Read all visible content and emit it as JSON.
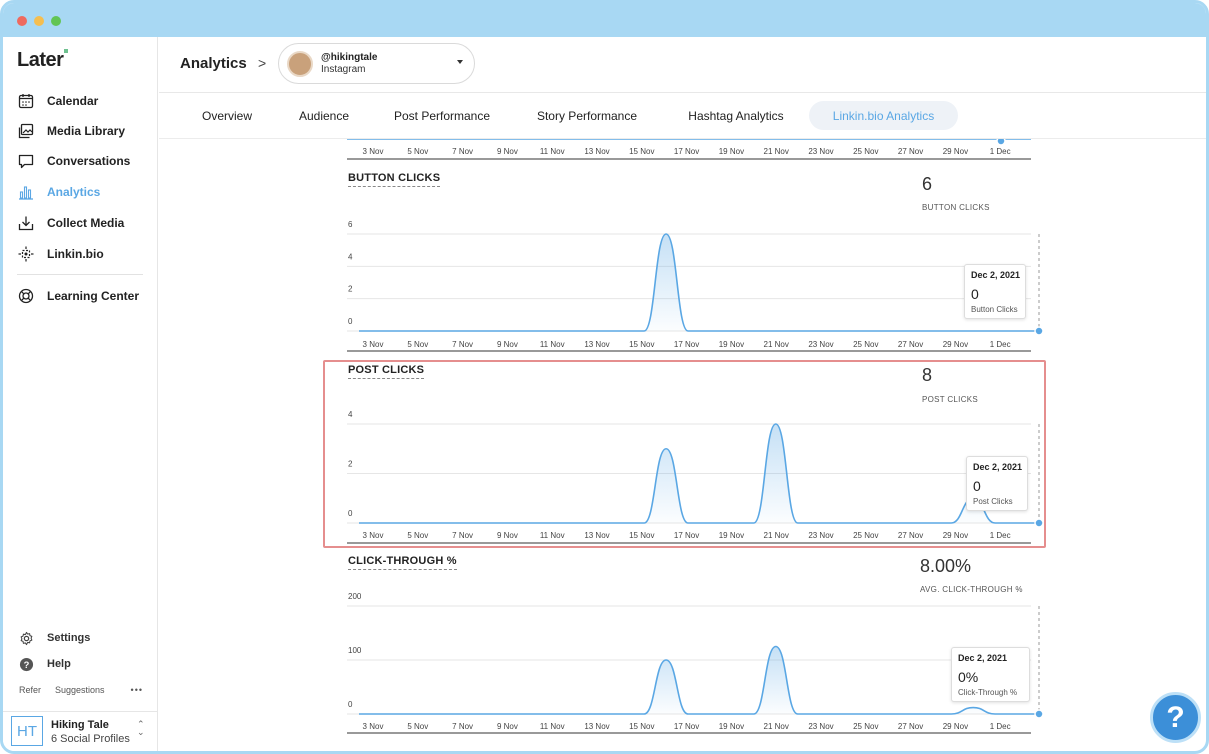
{
  "app": {
    "logo_text": "Later",
    "accent_color": "#5aa7e4"
  },
  "sidebar": {
    "items": [
      {
        "label": "Calendar",
        "icon": "calendar-icon"
      },
      {
        "label": "Media Library",
        "icon": "media-library-icon"
      },
      {
        "label": "Conversations",
        "icon": "conversations-icon"
      },
      {
        "label": "Analytics",
        "icon": "analytics-icon",
        "active": true
      },
      {
        "label": "Collect Media",
        "icon": "collect-media-icon"
      },
      {
        "label": "Linkin.bio",
        "icon": "linkinbio-icon"
      }
    ],
    "learning": {
      "label": "Learning Center",
      "icon": "learning-center-icon"
    },
    "settings": {
      "label": "Settings",
      "icon": "gear-icon"
    },
    "help": {
      "label": "Help",
      "icon": "help-icon"
    },
    "refer": {
      "label": "Refer",
      "suggestions": "Suggestions",
      "more": "•••"
    },
    "profile": {
      "initials": "HT",
      "name": "Hiking Tale",
      "sub": "6 Social Profiles"
    }
  },
  "header": {
    "title": "Analytics",
    "breadcrumb_sep": ">",
    "account": {
      "handle": "@hikingtale",
      "network": "Instagram"
    }
  },
  "tabs": [
    {
      "label": "Overview"
    },
    {
      "label": "Audience"
    },
    {
      "label": "Post Performance"
    },
    {
      "label": "Story Performance"
    },
    {
      "label": "Hashtag Analytics"
    },
    {
      "label": "Linkin.bio Analytics",
      "active": true
    }
  ],
  "x_ticks": [
    "3 Nov",
    "5 Nov",
    "7 Nov",
    "9 Nov",
    "11 Nov",
    "13 Nov",
    "15 Nov",
    "17 Nov",
    "19 Nov",
    "21 Nov",
    "23 Nov",
    "25 Nov",
    "27 Nov",
    "29 Nov",
    "1 Dec"
  ],
  "charts": {
    "button_clicks": {
      "title": "BUTTON CLICKS",
      "total": "6",
      "total_label": "BUTTON CLICKS",
      "y_ticks": [
        "6",
        "4",
        "2",
        "0"
      ],
      "tooltip": {
        "date": "Dec 2, 2021",
        "value": "0",
        "label": "Button Clicks"
      }
    },
    "post_clicks": {
      "title": "POST CLICKS",
      "total": "8",
      "total_label": "POST CLICKS",
      "y_ticks": [
        "4",
        "2",
        "0"
      ],
      "tooltip": {
        "date": "Dec 2, 2021",
        "value": "0",
        "label": "Post Clicks"
      }
    },
    "click_through": {
      "title": "CLICK-THROUGH %",
      "total": "8.00%",
      "total_label": "AVG. CLICK-THROUGH %",
      "y_ticks": [
        "200",
        "100",
        "0"
      ],
      "tooltip": {
        "date": "Dec 2, 2021",
        "value": "0%",
        "label": "Click-Through %"
      }
    }
  },
  "chart_data": [
    {
      "type": "area",
      "title": "BUTTON CLICKS",
      "x": [
        "Nov 1",
        "Nov 2",
        "Nov 3",
        "Nov 4",
        "Nov 5",
        "Nov 6",
        "Nov 7",
        "Nov 8",
        "Nov 9",
        "Nov 10",
        "Nov 11",
        "Nov 12",
        "Nov 13",
        "Nov 14",
        "Nov 15",
        "Nov 16",
        "Nov 17",
        "Nov 18",
        "Nov 19",
        "Nov 20",
        "Nov 21",
        "Nov 22",
        "Nov 23",
        "Nov 24",
        "Nov 25",
        "Nov 26",
        "Nov 27",
        "Nov 28",
        "Nov 29",
        "Nov 30",
        "Dec 1",
        "Dec 2"
      ],
      "values": [
        0,
        0,
        0,
        0,
        0,
        0,
        0,
        0,
        0,
        0,
        0,
        0,
        0,
        0,
        6,
        0,
        0,
        0,
        0,
        0,
        0,
        0,
        0,
        0,
        0,
        0,
        0,
        0,
        0,
        0,
        0,
        0
      ],
      "ylim": [
        0,
        6
      ]
    },
    {
      "type": "area",
      "title": "POST CLICKS",
      "x": [
        "Nov 1",
        "Nov 2",
        "Nov 3",
        "Nov 4",
        "Nov 5",
        "Nov 6",
        "Nov 7",
        "Nov 8",
        "Nov 9",
        "Nov 10",
        "Nov 11",
        "Nov 12",
        "Nov 13",
        "Nov 14",
        "Nov 15",
        "Nov 16",
        "Nov 17",
        "Nov 18",
        "Nov 19",
        "Nov 20",
        "Nov 21",
        "Nov 22",
        "Nov 23",
        "Nov 24",
        "Nov 25",
        "Nov 26",
        "Nov 27",
        "Nov 28",
        "Nov 29",
        "Nov 30",
        "Dec 1",
        "Dec 2"
      ],
      "values": [
        0,
        0,
        0,
        0,
        0,
        0,
        0,
        0,
        0,
        0,
        0,
        0,
        0,
        0,
        3,
        0,
        0,
        0,
        0,
        4,
        0,
        0,
        0,
        0,
        0,
        0,
        0,
        0,
        1,
        0,
        0,
        0
      ],
      "ylim": [
        0,
        4
      ]
    },
    {
      "type": "area",
      "title": "CLICK-THROUGH %",
      "x": [
        "Nov 1",
        "Nov 2",
        "Nov 3",
        "Nov 4",
        "Nov 5",
        "Nov 6",
        "Nov 7",
        "Nov 8",
        "Nov 9",
        "Nov 10",
        "Nov 11",
        "Nov 12",
        "Nov 13",
        "Nov 14",
        "Nov 15",
        "Nov 16",
        "Nov 17",
        "Nov 18",
        "Nov 19",
        "Nov 20",
        "Nov 21",
        "Nov 22",
        "Nov 23",
        "Nov 24",
        "Nov 25",
        "Nov 26",
        "Nov 27",
        "Nov 28",
        "Nov 29",
        "Nov 30",
        "Dec 1",
        "Dec 2"
      ],
      "values": [
        0,
        0,
        0,
        0,
        0,
        0,
        0,
        0,
        0,
        0,
        0,
        0,
        0,
        0,
        100,
        0,
        0,
        0,
        0,
        125,
        0,
        0,
        0,
        0,
        0,
        0,
        0,
        0,
        12,
        0,
        0,
        0
      ],
      "ylim": [
        0,
        200
      ]
    }
  ]
}
